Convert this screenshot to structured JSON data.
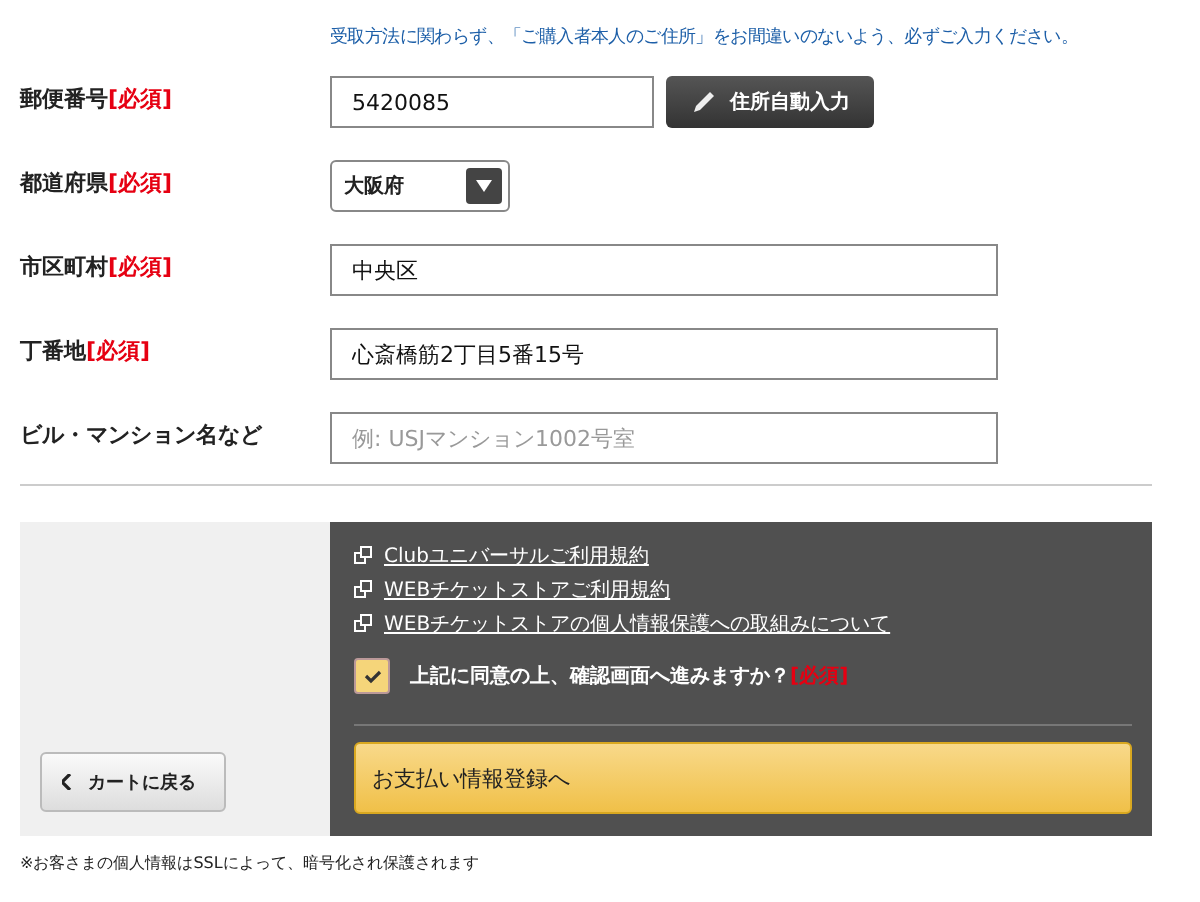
{
  "notice": "受取方法に関わらず、「ご購入者本人のご住所」をお間違いのないよう、必ずご入力ください。",
  "fields": [
    {
      "kind": "text",
      "label": "郵便番号",
      "required": "[必須]",
      "value": "5420085",
      "button": "住所自動入力"
    },
    {
      "kind": "select",
      "label": "都道府県",
      "required": "[必須]",
      "value": "大阪府"
    },
    {
      "kind": "text",
      "label": "市区町村",
      "required": "[必須]",
      "value": "中央区"
    },
    {
      "kind": "text",
      "label": "丁番地",
      "required": "[必須]",
      "value": "心斎橋筋2丁目5番15号"
    },
    {
      "kind": "text",
      "label": "ビル・マンション名など",
      "placeholder": "例: USJマンション1002号室"
    }
  ],
  "back_button": "カートに戻る",
  "links": [
    "Clubユニバーサルご利用規約",
    "WEBチケットストアご利用規約",
    "WEBチケットストアの個人情報保護への取組みについて"
  ],
  "agree": {
    "label": "上記に同意の上、確認画面へ進みますか？",
    "required": "[必須]",
    "checked": true
  },
  "submit_button": "お支払い情報登録へ",
  "footnote": "※お客さまの個人情報はSSLによって、暗号化され保護されます"
}
